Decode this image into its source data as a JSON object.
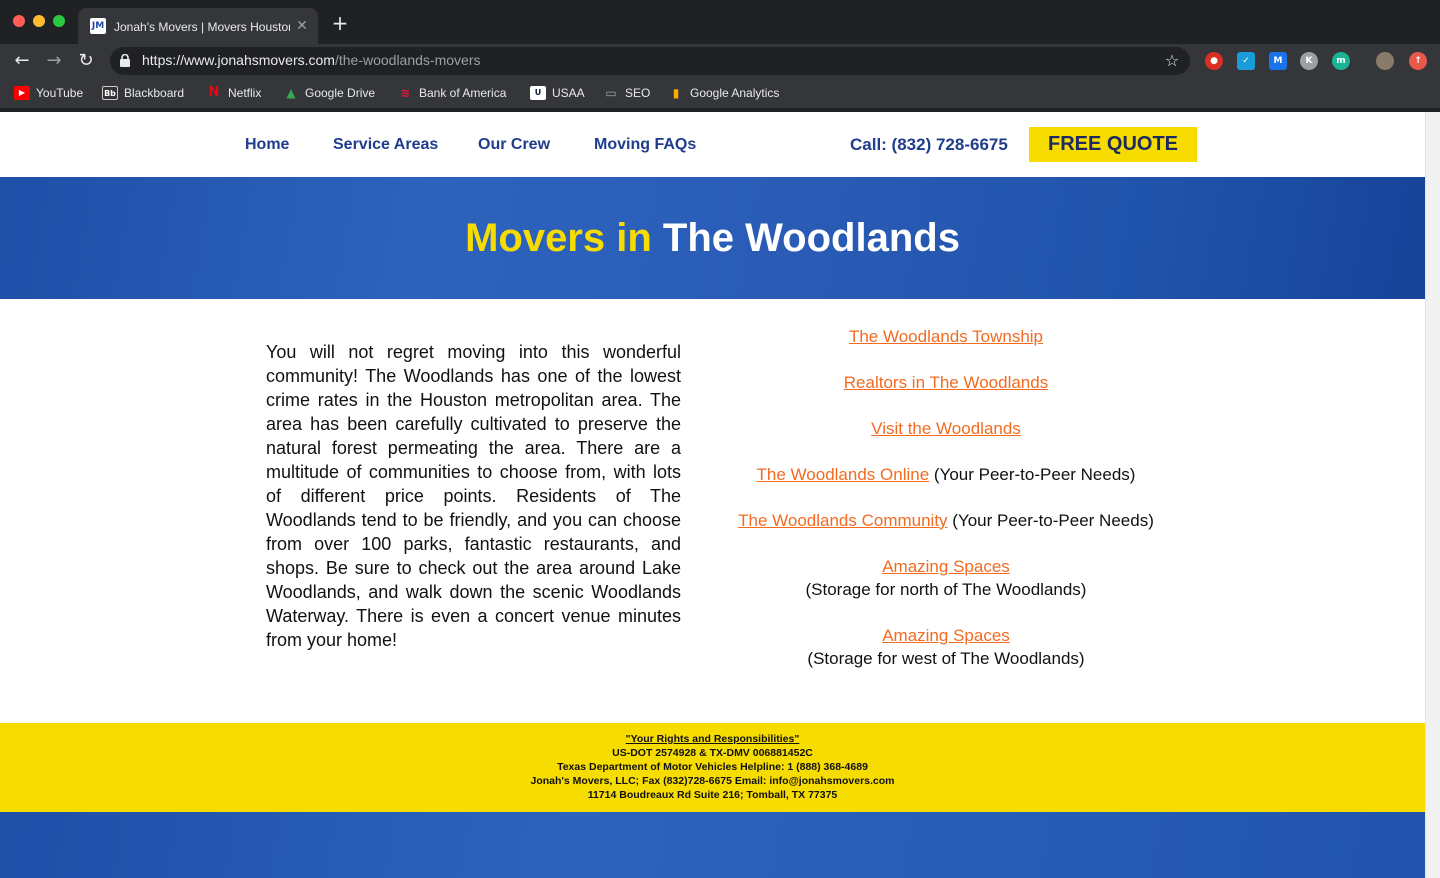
{
  "browser": {
    "tab_title": "Jonah's Movers | Movers Houston",
    "tab_favicon_text": "JM",
    "url_host": "https://www.jonahsmovers.com",
    "url_path": "/the-woodlands-movers",
    "bookmarks": [
      {
        "label": "YouTube",
        "icon": "youtube-icon",
        "color": "#ff0000"
      },
      {
        "label": "Blackboard",
        "icon": "blackboard-icon",
        "color": "#333333"
      },
      {
        "label": "Netflix",
        "icon": "netflix-icon",
        "color": "#e50914"
      },
      {
        "label": "Google Drive",
        "icon": "google-drive-icon",
        "color": "#34a853"
      },
      {
        "label": "Bank of America",
        "icon": "bank-of-america-icon",
        "color": "#e31837"
      },
      {
        "label": "USAA",
        "icon": "usaa-icon",
        "color": "#ffffff"
      },
      {
        "label": "SEO",
        "icon": "folder-icon",
        "color": "#9aa0a6"
      },
      {
        "label": "Google Analytics",
        "icon": "google-analytics-icon",
        "color": "#f9ab00"
      }
    ]
  },
  "nav": {
    "home": "Home",
    "service_areas": "Service Areas",
    "our_crew": "Our Crew",
    "faqs": "Moving FAQs",
    "call": "Call: (832) 728-6675",
    "quote": "FREE QUOTE"
  },
  "hero": {
    "title_yellow": "Movers in",
    "title_white": "The Woodlands"
  },
  "body": {
    "paragraph": "You will not regret moving into this wonderful community! The Woodlands has one of the lowest crime rates in the Houston metropolitan area. The area has been carefully cultivated to preserve the natural forest permeating the area. There are a multitude of communities to choose from, with lots of different price points. Residents of The Woodlands tend to be friendly, and you can choose from over 100 parks, fantastic restaurants, and shops. Be sure to check out the area around Lake Woodlands, and walk down the scenic Woodlands Waterway. There is even a concert venue minutes from your home!"
  },
  "links": {
    "township": "The Woodlands Township",
    "realtors": "Realtors in The Woodlands",
    "visit": "Visit the Woodlands",
    "online": "The Woodlands Online",
    "online_note": " (Your Peer-to-Peer Needs)",
    "community": "The Woodlands Community",
    "community_note": " (Your Peer-to-Peer Needs)",
    "spaces_north": "Amazing Spaces",
    "spaces_north_note": "(Storage for north of The Woodlands)",
    "spaces_west": "Amazing Spaces",
    "spaces_west_note": "(Storage for west of The Woodlands)"
  },
  "footer": {
    "rights": "\"Your Rights and Responsibilities\"",
    "dot": "US-DOT 2574928 & TX-DMV 006881452C",
    "helpline": "Texas Department of Motor Vehicles Helpline: 1 (888) 368-4689",
    "contact": "Jonah's Movers, LLC; Fax (832)728-6675  Email: info@jonahsmovers.com",
    "address": "11714 Boudreaux Rd Suite 216; Tomball, TX 77375"
  },
  "colors": {
    "brand_blue": "#1f3d8c",
    "brand_yellow": "#f7dc00",
    "link_orange": "#f26b21"
  }
}
